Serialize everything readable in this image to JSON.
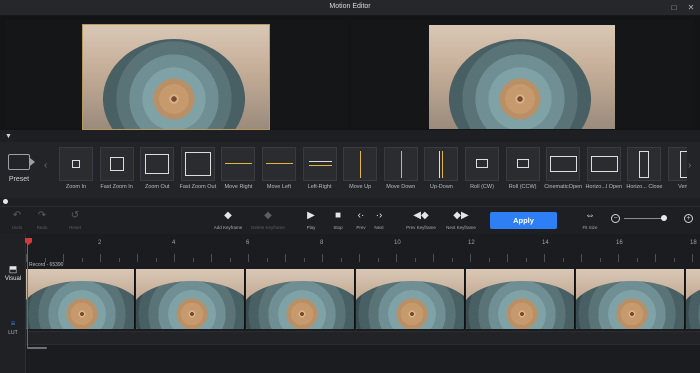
{
  "window": {
    "title": "Motion Editor"
  },
  "presets_panel": {
    "preset_label": "Preset"
  },
  "presets": [
    "Zoom In",
    "Fast Zoom In",
    "Zoom Out",
    "Fast Zoom Out",
    "Move Right",
    "Move Left",
    "Left-Right",
    "Move Up",
    "Move Down",
    "Up-Down",
    "Roll (CW)",
    "Roll (CCW)",
    "CinematicOpen",
    "Horizo...l Open",
    "Horizo... Close",
    "Vertic"
  ],
  "toolbar": {
    "undo": "Undo",
    "redo": "Redo",
    "reset": "Reset",
    "add_keyframe": "Add Keyframe",
    "delete_keyframe": "Delete Keyframe",
    "play": "Play",
    "stop": "Stop",
    "prev": "Prev",
    "next": "Next",
    "prev_keyframe": "Prev Keyframe",
    "next_keyframe": "Next Keyframe",
    "apply": "Apply",
    "fit_size": "Fit Size"
  },
  "timeline": {
    "ruler_labels": [
      "2",
      "4",
      "6",
      "8",
      "10",
      "12",
      "14",
      "16",
      "18"
    ],
    "clip_name": "Record - 65390",
    "tracks": {
      "visual": "Visual",
      "lut": "LUT"
    }
  },
  "colors": {
    "accent": "#2f7ff4",
    "playhead": "#d6393a",
    "selection": "#b79a62"
  }
}
